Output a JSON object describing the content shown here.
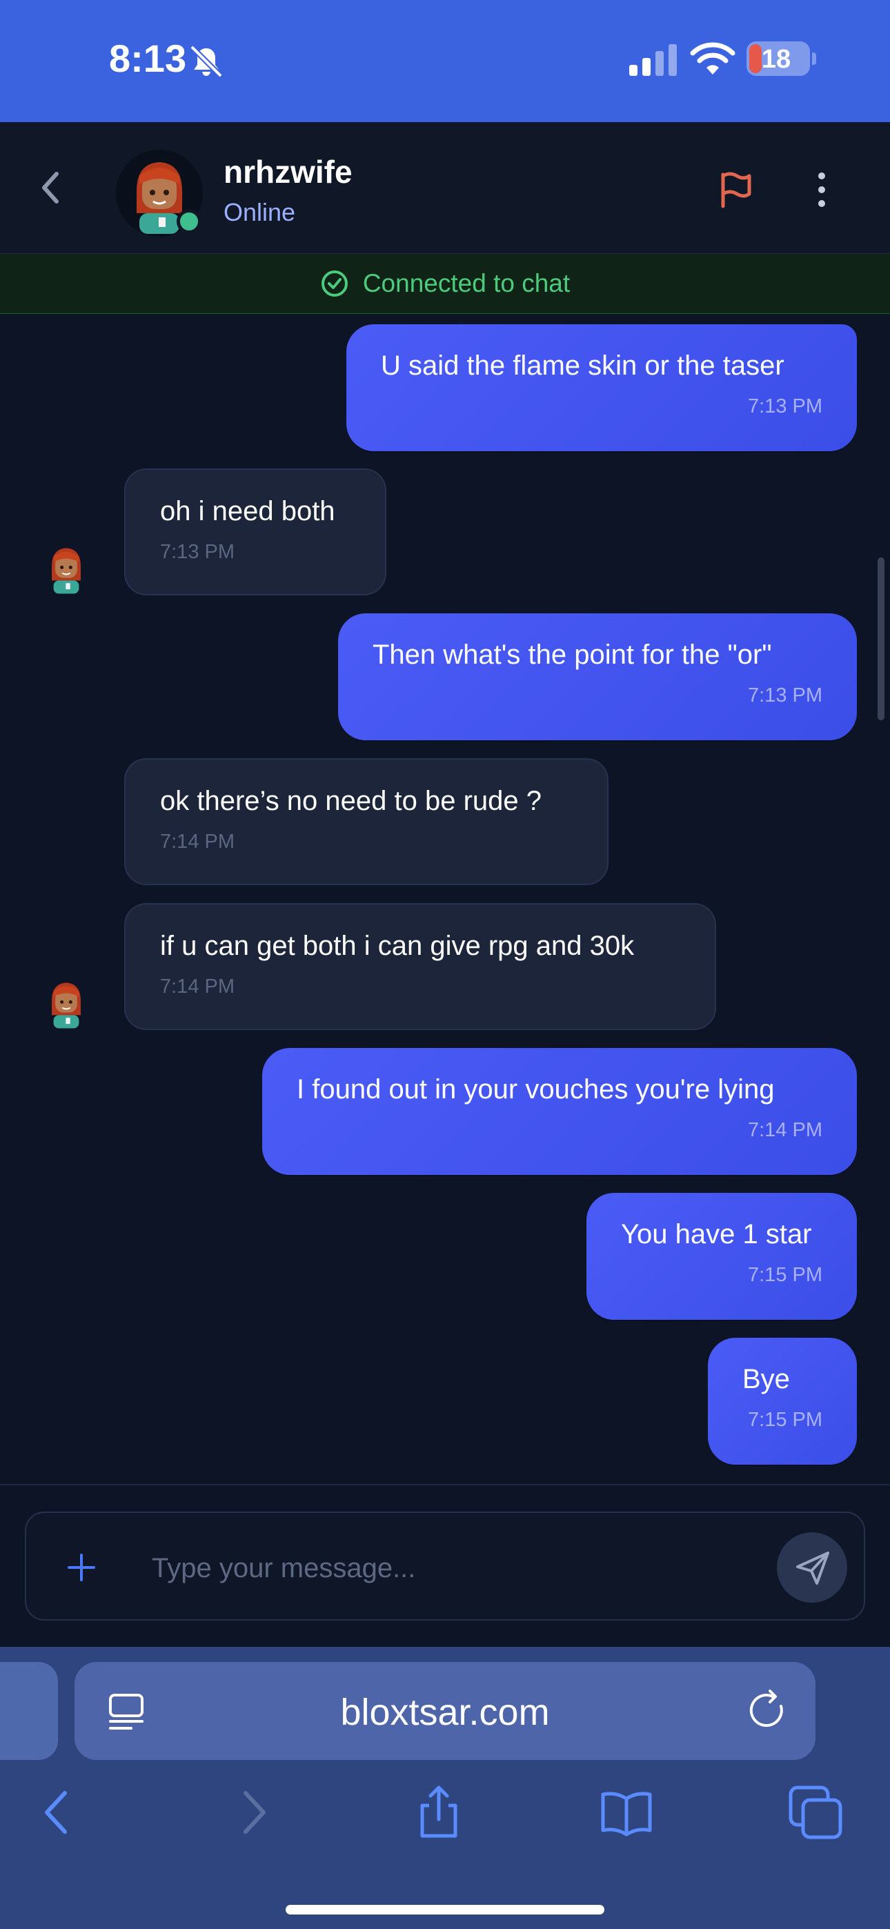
{
  "status_bar": {
    "time": "8:13",
    "battery": "18",
    "battery_level": 0.18,
    "icons": [
      "bell-slash-icon",
      "cellular-signal-icon",
      "wifi-icon",
      "battery-icon"
    ]
  },
  "header": {
    "username": "nrhzwife",
    "status": "Online",
    "icons": [
      "back-chevron-icon",
      "flag-icon",
      "more-vertical-icon"
    ]
  },
  "banner": {
    "text": "Connected to chat",
    "icon": "check-circle-icon"
  },
  "messages": [
    {
      "direction": "out",
      "text": "U said the flame skin or the taser",
      "time": "7:13 PM"
    },
    {
      "direction": "in",
      "text": "oh i need both",
      "time": "7:13 PM",
      "avatar": true
    },
    {
      "direction": "out",
      "text": "Then what's the point for the \"or\"",
      "time": "7:13 PM"
    },
    {
      "direction": "in",
      "text": "ok there’s no need to be rude ?",
      "time": "7:14 PM",
      "avatar": false
    },
    {
      "direction": "in",
      "text": "if u can get both i can give rpg and 30k",
      "time": "7:14 PM",
      "avatar": true
    },
    {
      "direction": "out",
      "text": "I found out in your vouches you're lying",
      "time": "7:14 PM"
    },
    {
      "direction": "out",
      "text": "You have 1 star",
      "time": "7:15 PM"
    },
    {
      "direction": "out",
      "text": "Bye",
      "time": "7:15 PM"
    }
  ],
  "composer": {
    "placeholder": "Type your message...",
    "value": "",
    "icons": [
      "plus-icon",
      "send-icon"
    ]
  },
  "browser": {
    "url": "bloxtsar.com",
    "icons": [
      "reader-icon",
      "reload-icon",
      "back-arrow-icon",
      "forward-arrow-icon",
      "share-icon",
      "bookmarks-icon",
      "tabs-icon"
    ]
  },
  "colors": {
    "status_bar_bg": "#3b63e0",
    "app_bg": "#0d1426",
    "outgoing_bubble": "#4354f0",
    "incoming_bubble": "#1c2539",
    "online": "#3fbf8e",
    "connected_text": "#4ccb7d",
    "flag": "#e3674f",
    "browser_bg": "#2f4580"
  }
}
